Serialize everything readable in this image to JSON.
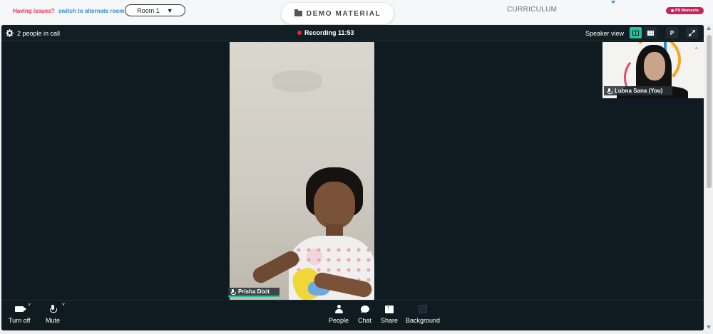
{
  "topbar": {
    "issues_text": "Having issues?",
    "alternate_link": "switch to alternate room",
    "room_select": "Room 1",
    "demo_material": "DEMO MATERIAL",
    "curriculum": "CURRICULUM",
    "ps_moments": "PS Moments"
  },
  "call": {
    "people_count": "2 people in call",
    "recording": "Recording 11:53",
    "speaker_view": "Speaker view",
    "p_button": "P",
    "main_participant": "Prisha Dixit",
    "self_participant": "Lubna Sana (You)"
  },
  "controls": {
    "turn_off": "Turn off",
    "mute": "Mute",
    "people": "People",
    "chat": "Chat",
    "share": "Share",
    "background": "Background"
  },
  "colors": {
    "accent_green": "#22c39b",
    "recording_red": "#e8283c",
    "brand_pink": "#c8245a",
    "call_bg": "#0f1b21"
  }
}
